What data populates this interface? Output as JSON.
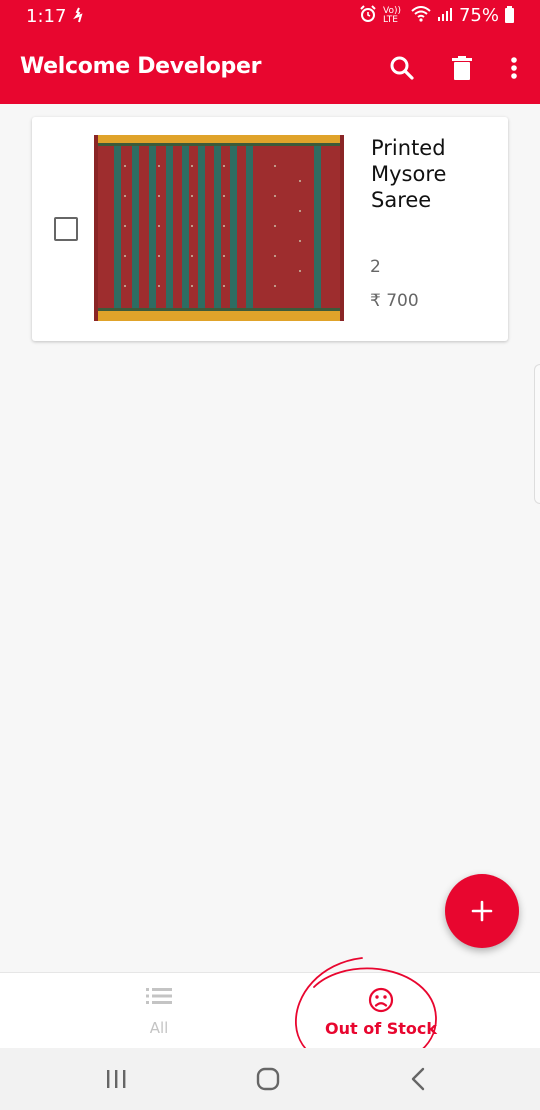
{
  "status_bar": {
    "time": "1:17",
    "network": "Vo)) LTE",
    "battery": "75%"
  },
  "app_bar": {
    "title": "Welcome Developer",
    "actions": [
      "search-icon",
      "delete-icon",
      "more-vert-icon"
    ],
    "color": "#e8062f"
  },
  "products": [
    {
      "name": "Printed Mysore Saree",
      "quantity": "2",
      "price": "₹ 700",
      "checked": false
    }
  ],
  "fab": {
    "icon": "plus-icon"
  },
  "bottom_nav": {
    "items": [
      {
        "label": "All",
        "icon": "list-icon",
        "active": false
      },
      {
        "label": "Out of Stock",
        "icon": "sad-face-icon",
        "active": true
      }
    ],
    "active_color": "#e8062f"
  },
  "system_nav": [
    "recents-icon",
    "home-icon",
    "back-icon"
  ]
}
